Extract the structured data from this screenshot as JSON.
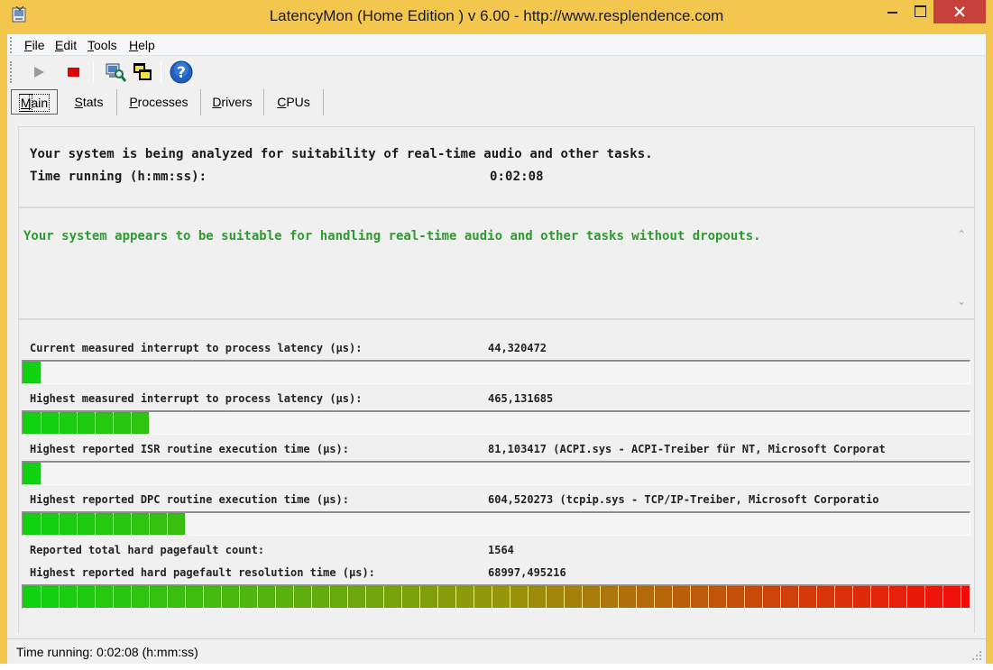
{
  "window": {
    "title": "LatencyMon  (Home Edition )  v 6.00 - http://www.resplendence.com",
    "icon": "latencymon-app-icon",
    "title_bar_color": "#f3c64e",
    "close_button_color": "#c7403a"
  },
  "menu": [
    {
      "label": "File",
      "underline": "F",
      "rest": "ile"
    },
    {
      "label": "Edit",
      "underline": "E",
      "rest": "dit"
    },
    {
      "label": "Tools",
      "underline": "T",
      "rest": "ools"
    },
    {
      "label": "Help",
      "underline": "H",
      "rest": "elp"
    }
  ],
  "toolbar": [
    {
      "name": "start-icon",
      "glyph": "play",
      "enabled": false
    },
    {
      "name": "stop-icon",
      "glyph": "stop",
      "color": "#e00000"
    },
    {
      "name": "analyze-icon",
      "glyph": "computer-magnifier"
    },
    {
      "name": "windows-icon",
      "glyph": "overlapping-windows"
    },
    {
      "name": "help-icon",
      "glyph": "question-mark",
      "color": "#1f5fc4"
    }
  ],
  "tabs": [
    {
      "label": "Main",
      "u": "M",
      "rest": "ain",
      "active": true
    },
    {
      "label": "Stats",
      "u": "S",
      "rest": "tats",
      "active": false
    },
    {
      "label": "Processes",
      "u": "P",
      "rest": "rocesses",
      "active": false
    },
    {
      "label": "Drivers",
      "u": "D",
      "rest": "rivers",
      "active": false
    },
    {
      "label": "CPUs",
      "u": "C",
      "rest": "PUs",
      "active": false
    }
  ],
  "info": {
    "line1": "Your system is being analyzed for suitability of real-time audio and other tasks.",
    "time_label": "Time running (h:mm:ss):",
    "time_value": "0:02:08"
  },
  "verdict": {
    "text": "Your system appears to be suitable for handling real-time audio and other tasks without dropouts.",
    "color": "#2f9a2f"
  },
  "metrics": [
    {
      "label": "Current measured interrupt to process latency (µs):",
      "value": "44,320472",
      "bar_segments": 1
    },
    {
      "label": "Highest measured interrupt to process latency (µs):",
      "value": "465,131685",
      "bar_segments": 7
    },
    {
      "label": "Highest reported ISR routine execution time (µs):",
      "value": "81,103417   (ACPI.sys - ACPI-Treiber für NT, Microsoft Corporat",
      "bar_segments": 1
    },
    {
      "label": "Highest reported DPC routine execution time (µs):",
      "value": "604,520273  (tcpip.sys - TCP/IP-Treiber, Microsoft Corporatio",
      "bar_segments": 9
    },
    {
      "label": "Reported total hard pagefault count:",
      "value": "1564"
    },
    {
      "label": "Highest reported hard pagefault resolution time (µs):",
      "value": "68997,495216",
      "bar_segments": 53
    }
  ],
  "status": {
    "text": "Time running: 0:02:08  (h:mm:ss)"
  }
}
